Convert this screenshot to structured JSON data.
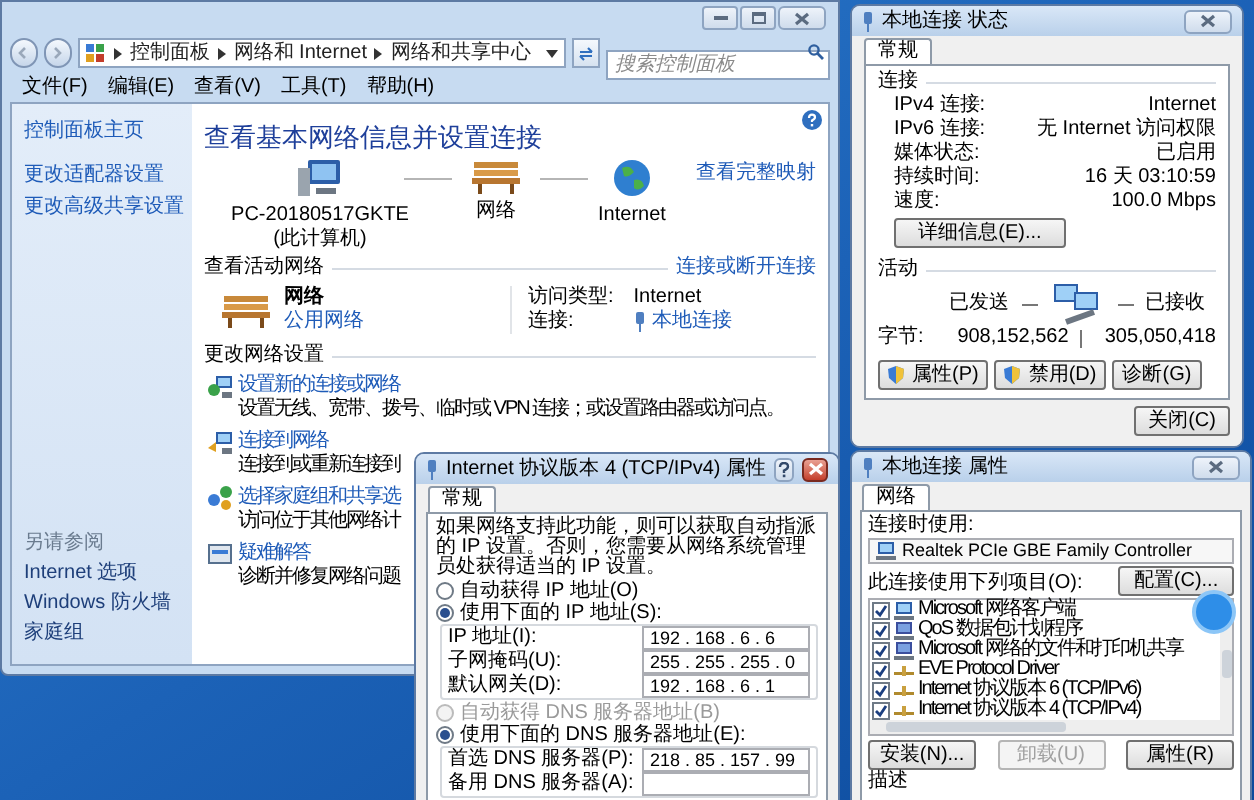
{
  "main_window": {
    "breadcrumb": [
      "控制面板",
      "网络和 Internet",
      "网络和共享中心"
    ],
    "search": {
      "placeholder": "搜索控制面板"
    },
    "menu": [
      "文件(F)",
      "编辑(E)",
      "查看(V)",
      "工具(T)",
      "帮助(H)"
    ],
    "sidebar": {
      "links": [
        "控制面板主页",
        "更改适配器设置",
        "更改高级共享设置"
      ],
      "see_also_title": "另请参阅",
      "see_also": [
        "Internet 选项",
        "Windows 防火墙",
        "家庭组"
      ]
    },
    "heading": "查看基本网络信息并设置连接",
    "full_map_link": "查看完整映射",
    "map_nodes": [
      {
        "kind": "computer",
        "label": "PC-20180517GKTE",
        "sublabel": "(此计算机)"
      },
      {
        "kind": "network",
        "label": "网络"
      },
      {
        "kind": "internet",
        "label": "Internet"
      }
    ],
    "active_networks": {
      "title": "查看活动网络",
      "link": "连接或断开连接",
      "name": "网络",
      "type": "公用网络",
      "access_label": "访问类型:",
      "access_value": "Internet",
      "connection_label": "连接:",
      "connection_value": "本地连接"
    },
    "settings": {
      "title": "更改网络设置",
      "items": [
        {
          "kind": "new-connection",
          "title": "设置新的连接或网络",
          "desc": "设置无线、宽带、拨号、临时或 VPN 连接；或设置路由器或访问点。"
        },
        {
          "kind": "connect",
          "title": "连接到网络",
          "desc": "连接到或重新连接到"
        },
        {
          "kind": "homegroup",
          "title": "选择家庭组和共享选",
          "desc": "访问位于其他网络计"
        },
        {
          "kind": "troubleshoot",
          "title": "疑难解答",
          "desc": "诊断并修复网络问题"
        }
      ]
    }
  },
  "status_window": {
    "title": "本地连接 状态",
    "tab": "常规",
    "connection_title": "连接",
    "rows": [
      {
        "label": "IPv4 连接:",
        "value": "Internet"
      },
      {
        "label": "IPv6 连接:",
        "value": "无 Internet 访问权限"
      },
      {
        "label": "媒体状态:",
        "value": "已启用"
      },
      {
        "label": "持续时间:",
        "value": "16 天 03:10:59"
      },
      {
        "label": "速度:",
        "value": "100.0 Mbps"
      }
    ],
    "details_button": "详细信息(E)...",
    "activity_title": "活动",
    "sent": "已发送",
    "received": "已接收",
    "bytes_label": "字节:",
    "bytes_sent": "908,152,562",
    "bytes_received": "305,050,418",
    "buttons": [
      {
        "label": "属性(P)",
        "shield": true
      },
      {
        "label": "禁用(D)",
        "shield": true
      },
      {
        "label": "诊断(G)",
        "shield": false
      }
    ],
    "close_button": "关闭(C)"
  },
  "tcp_dialog": {
    "title": "Internet 协议版本 4 (TCP/IPv4) 属性",
    "tab": "常规",
    "intro": "如果网络支持此功能，则可以获取自动指派的 IP 设置。否则，您需要从网络系统管理员处获得适当的 IP 设置。",
    "ip_options": [
      {
        "label": "自动获得 IP 地址(O)",
        "selected": false,
        "disabled": false
      },
      {
        "label": "使用下面的 IP 地址(S):",
        "selected": true,
        "disabled": false
      }
    ],
    "ip_fields": [
      {
        "label": "IP 地址(I):",
        "value": "192 . 168 . 6 . 6"
      },
      {
        "label": "子网掩码(U):",
        "value": "255 . 255 . 255 . 0"
      },
      {
        "label": "默认网关(D):",
        "value": "192 . 168 . 6 . 1"
      }
    ],
    "dns_options": [
      {
        "label": "自动获得 DNS 服务器地址(B)",
        "selected": false,
        "disabled": true
      },
      {
        "label": "使用下面的 DNS 服务器地址(E):",
        "selected": true,
        "disabled": false
      }
    ],
    "dns_fields": [
      {
        "label": "首选 DNS 服务器(P):",
        "value": "218 . 85 . 157 . 99"
      },
      {
        "label": "备用 DNS 服务器(A):"
      }
    ]
  },
  "properties_window": {
    "title": "本地连接 属性",
    "tab": "网络",
    "connect_using_label": "连接时使用:",
    "adapter": "Realtek PCIe GBE Family Controller",
    "configure_button": "配置(C)...",
    "items_label": "此连接使用下列项目(O):",
    "items": [
      {
        "kind": "client",
        "label": "Microsoft 网络客户端",
        "checked": true
      },
      {
        "kind": "service",
        "label": "QoS 数据包计划程序",
        "checked": true
      },
      {
        "kind": "service",
        "label": "Microsoft 网络的文件和打印机共享",
        "checked": true
      },
      {
        "kind": "protocol",
        "label": "EVE Protocol Driver",
        "checked": true
      },
      {
        "kind": "protocol",
        "label": "Internet 协议版本 6 (TCP/IPv6)",
        "checked": true
      },
      {
        "kind": "protocol",
        "label": "Internet 协议版本 4 (TCP/IPv4)",
        "checked": true
      }
    ],
    "buttons": [
      {
        "label": "安装(N)...",
        "disabled": false
      },
      {
        "label": "卸载(U)",
        "disabled": true
      },
      {
        "label": "属性(R)",
        "disabled": false
      }
    ],
    "description_label": "描述"
  }
}
